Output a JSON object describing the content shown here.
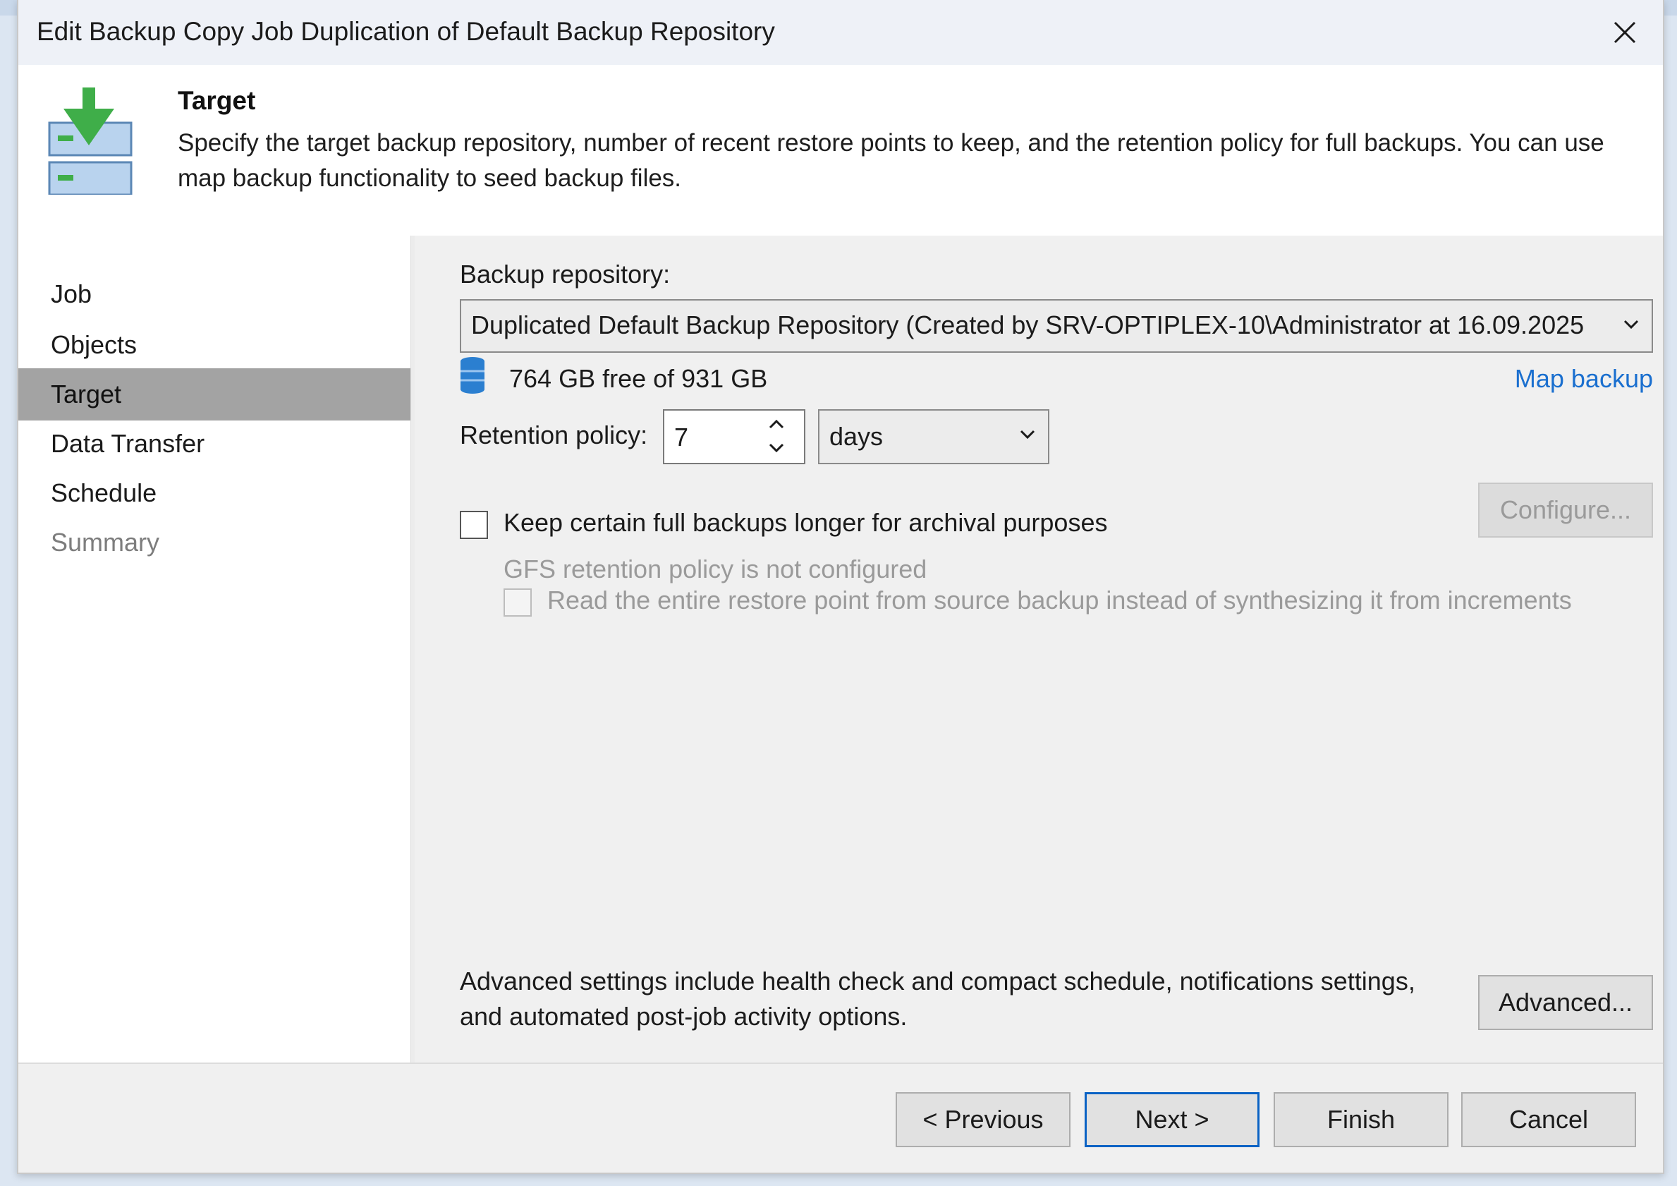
{
  "window": {
    "title": "Edit Backup Copy Job Duplication of Default Backup Repository",
    "close_icon": "close-icon"
  },
  "header": {
    "icon": "backup-target-icon",
    "title": "Target",
    "description": "Specify the target backup repository, number of recent restore points to keep, and the retention policy for full backups. You can use map backup functionality to seed backup files."
  },
  "sidebar": {
    "items": [
      {
        "label": "Job",
        "state": "normal"
      },
      {
        "label": "Objects",
        "state": "normal"
      },
      {
        "label": "Target",
        "state": "active"
      },
      {
        "label": "Data Transfer",
        "state": "normal"
      },
      {
        "label": "Schedule",
        "state": "normal"
      },
      {
        "label": "Summary",
        "state": "disabled"
      }
    ]
  },
  "target": {
    "repository_label": "Backup repository:",
    "repository_value": "Duplicated Default Backup Repository (Created by SRV-OPTIPLEX-10\\Administrator at 16.09.2025",
    "free_space": "764 GB free of 931 GB",
    "map_backup_link": "Map backup",
    "retention_label": "Retention policy:",
    "retention_value": "7",
    "retention_unit": "days",
    "gfs_checkbox_label": "Keep certain full backups longer for archival purposes",
    "gfs_checked": false,
    "configure_button": "Configure...",
    "gfs_status": "GFS retention policy is not configured",
    "read_entire_label": "Read the entire restore point from source backup instead of synthesizing it from increments",
    "read_entire_checked": false,
    "advanced_text": "Advanced settings include health check and compact schedule, notifications settings, and automated post-job activity options.",
    "advanced_button": "Advanced..."
  },
  "footer": {
    "previous_button": "< Previous",
    "next_button": "Next >",
    "finish_button": "Finish",
    "cancel_button": "Cancel"
  },
  "colors": {
    "link": "#1a6fcf",
    "active_nav": "#a3a3a3",
    "default_button_border": "#0a62c4",
    "icon_green": "#3fae49",
    "icon_blue": "#b9d3ee",
    "db_icon_blue": "#2b7fd0"
  }
}
